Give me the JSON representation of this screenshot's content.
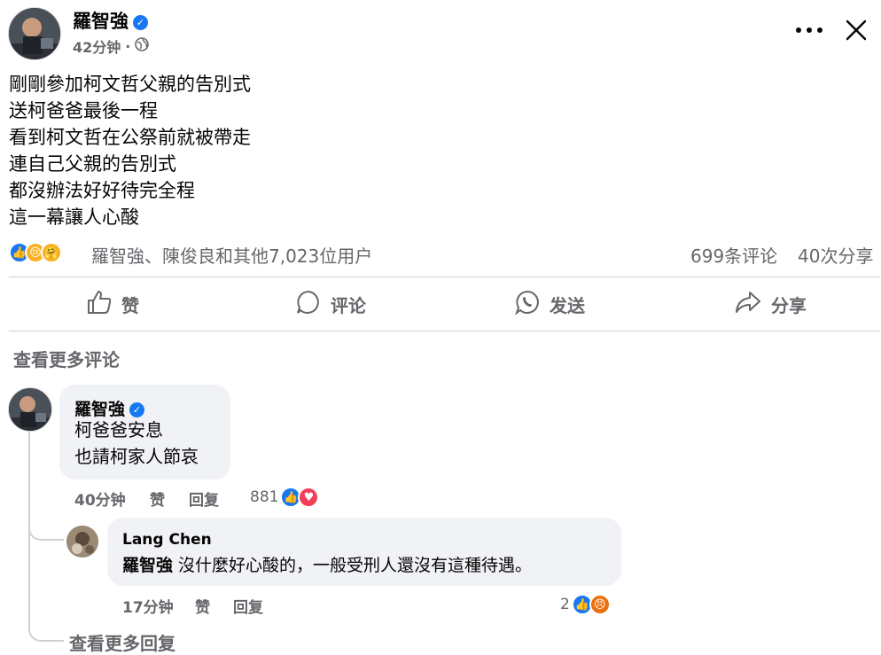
{
  "post": {
    "author": "羅智強",
    "time": "42分钟",
    "separator": "·",
    "lines": [
      "剛剛參加柯文哲父親的告別式",
      "送柯爸爸最後一程",
      "看到柯文哲在公祭前就被帶走",
      "連自己父親的告別式",
      "都沒辦法好好待完全程",
      "這一幕讓人心酸"
    ]
  },
  "reactions": {
    "summary": "羅智強、陳俊良和其他7,023位用户",
    "comments_count": "699条评论",
    "shares_count": "40次分享"
  },
  "actions": {
    "like": "赞",
    "comment": "评论",
    "send": "发送",
    "share": "分享"
  },
  "view_more_comments": "查看更多评论",
  "comment1": {
    "author": "羅智強",
    "lines": [
      "柯爸爸安息",
      "也請柯家人節哀"
    ],
    "time": "40分钟",
    "like": "赞",
    "reply": "回复",
    "reaction_count": "881"
  },
  "reply1": {
    "author": "Lang Chen",
    "mention": "羅智強",
    "text": " 沒什麼好心酸的，一般受刑人還沒有這種待遇。",
    "time": "17分钟",
    "like": "赞",
    "reply": "回复",
    "reaction_count": "2"
  },
  "view_more_replies": "查看更多回复",
  "colors": {
    "accent": "#1877f2",
    "love": "#f33e58",
    "angry": "#e9710f",
    "muted": "#65676b"
  }
}
